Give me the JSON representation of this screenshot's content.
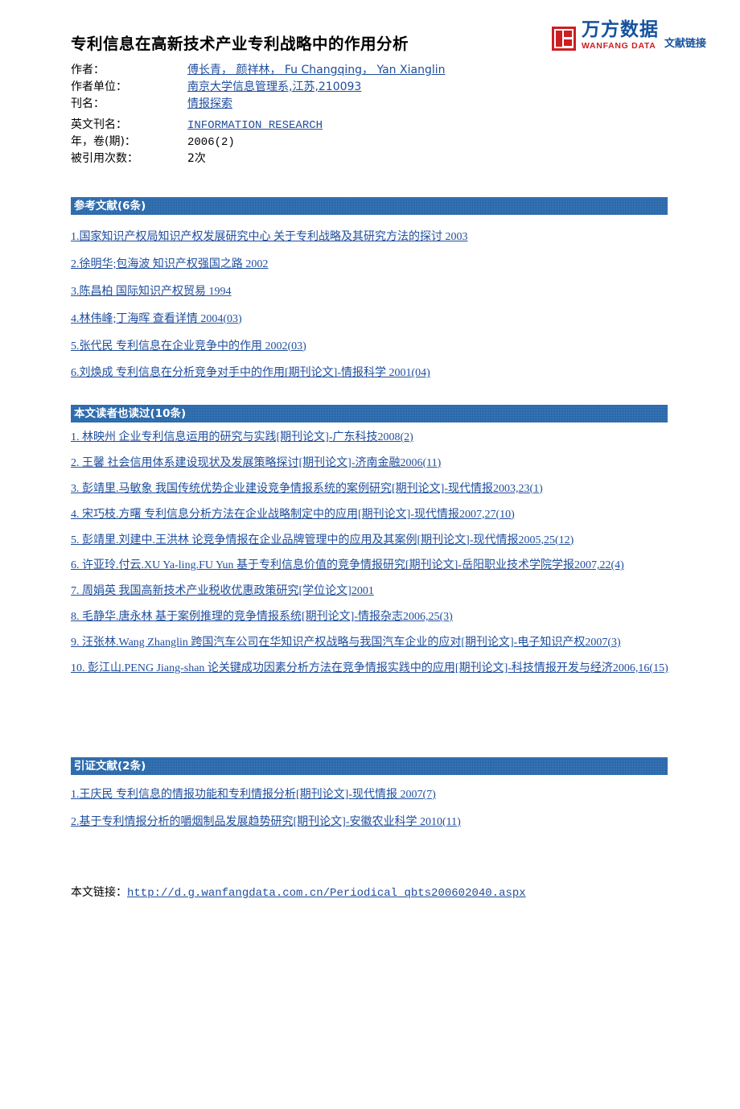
{
  "brand": {
    "mark_icon": "wanfang-square-logo",
    "cn_name": "万方数据",
    "en_name": "WANFANG DATA",
    "tagline": "文献链接",
    "red": "#cc1f21",
    "blue": "#14529e"
  },
  "article": {
    "title": "专利信息在高新技术产业专利战略中的作用分析",
    "meta": [
      {
        "label": "作者：",
        "value": "傅长青， 颜祥林， Fu Changqing， Yan Xianglin"
      },
      {
        "label": "作者单位：",
        "value": "南京大学信息管理系,江苏,210093"
      },
      {
        "label": "刊名：",
        "value": "情报探索"
      },
      {
        "label": "英文刊名：",
        "value": "INFORMATION RESEARCH"
      },
      {
        "label": "年，卷(期)：",
        "value": "2006(2)"
      },
      {
        "label": "被引用次数：",
        "value": "2次"
      }
    ]
  },
  "sections": {
    "references": {
      "heading": "参考文献(6条)",
      "items": [
        "1.国家知识产权局知识产权发展研究中心 关于专利战略及其研究方法的探讨 2003",
        "2.徐明华;包海波 知识产权强国之路 2002",
        "3.陈昌柏 国际知识产权贸易 1994",
        "4.林伟峰;丁海晖 查看详情 2004(03)",
        "5.张代民 专利信息在企业竞争中的作用 2002(03)",
        "6.刘焕成 专利信息在分析竞争对手中的作用[期刊论文]-情报科学 2001(04)"
      ]
    },
    "also_read": {
      "heading": "本文读者也读过(10条)",
      "items": [
        "1. 林映州 企业专利信息运用的研究与实践[期刊论文]-广东科技2008(2)",
        "2. 王馨 社会信用体系建设现状及发展策略探讨[期刊论文]-济南金融2006(11)",
        "3. 彭靖里.马敏象 我国传统优势企业建设竞争情报系统的案例研究[期刊论文]-现代情报2003,23(1)",
        "4. 宋巧枝.方曙 专利信息分析方法在企业战略制定中的应用[期刊论文]-现代情报2007,27(10)",
        "5. 彭靖里.刘建中.王洪林 论竞争情报在企业品牌管理中的应用及其案例[期刊论文]-现代情报2005,25(12)",
        "6. 许亚玲.付云.XU Ya-ling.FU Yun 基于专利信息价值的竞争情报研究[期刊论文]-岳阳职业技术学院学报2007,22(4)",
        "7. 周娟英 我国高新技术产业税收优惠政策研究[学位论文]2001",
        "8. 毛静华.唐永林 基于案例推理的竞争情报系统[期刊论文]-情报杂志2006,25(3)",
        "9. 汪张林.Wang Zhanglin 跨国汽车公司在华知识产权战略与我国汽车企业的应对[期刊论文]-电子知识产权2007(3)",
        "10. 彭江山.PENG Jiang-shan 论关键成功因素分析方法在竞争情报实践中的应用[期刊论文]-科技情报开发与经济2006,16(15)"
      ]
    },
    "citing": {
      "heading": "引证文献(2条)",
      "items": [
        "1.王庆民 专利信息的情报功能和专利情报分析[期刊论文]-现代情报 2007(7)",
        "2.基于专利情报分析的嚼烟制品发展趋势研究[期刊论文]-安徽农业科学 2010(11)"
      ]
    }
  },
  "footer": {
    "label": "本文链接：",
    "url": "http://d.g.wanfangdata.com.cn/Periodical_qbts200602040.aspx"
  }
}
